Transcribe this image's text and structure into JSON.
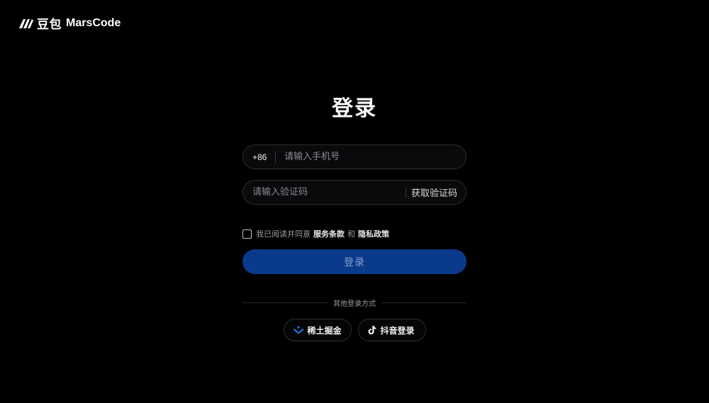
{
  "brand": {
    "icon": "marscode-logo-icon",
    "name_cn": "豆包",
    "name_en": "MarsCode"
  },
  "login": {
    "title": "登录",
    "phone": {
      "prefix": "+86",
      "placeholder": "请输入手机号",
      "value": ""
    },
    "code": {
      "placeholder": "请输入验证码",
      "value": "",
      "get_code_label": "获取验证码"
    },
    "agreement": {
      "checked": false,
      "text_before": "我已阅读并同意",
      "terms_link": "服务条款",
      "and": "和",
      "privacy_link": "隐私政策"
    },
    "submit_label": "登录",
    "other_methods_label": "其他登录方式",
    "social": [
      {
        "label": "稀土掘金",
        "icon": "juejin-icon",
        "color": "#1e80ff"
      },
      {
        "label": "抖音登录",
        "icon": "douyin-icon",
        "color": "#ffffff"
      }
    ]
  },
  "colors": {
    "background": "#000000",
    "primary_button": "#0a3a8c",
    "field_border": "#2e2e33"
  }
}
